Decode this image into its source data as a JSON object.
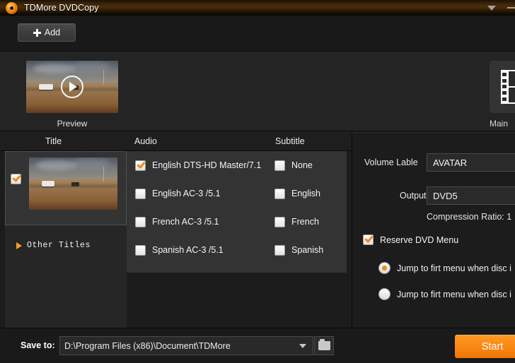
{
  "window": {
    "title": "TDMore DVDCopy",
    "app_icon": "dvd-disc-icon",
    "dropdown_icon": "chevron-down-icon",
    "minimize_icon": "minimize-icon",
    "accent_color": "#f28c13",
    "start_color": "#fa8a14"
  },
  "toolbar": {
    "add_label": "Add",
    "add_icon": "plus-icon"
  },
  "strip": {
    "preview_label": "Preview",
    "preview_play_icon": "play-icon",
    "main_label": "Main",
    "main_icon": "film-strip-icon"
  },
  "table": {
    "headers": [
      "Title",
      "Audio",
      "Subtitle"
    ],
    "title_row": {
      "checked": true,
      "thumbnail": "movie-thumbnail"
    },
    "other_titles_label": "Other Titles",
    "other_titles_icon": "triangle-right-icon",
    "audio_tracks": [
      {
        "label": "English DTS-HD Master/7.1",
        "checked": true
      },
      {
        "label": "English AC-3 /5.1",
        "checked": false
      },
      {
        "label": "French AC-3 /5.1",
        "checked": false
      },
      {
        "label": "Spanish AC-3 /5.1",
        "checked": false
      }
    ],
    "subtitles": [
      {
        "label": "None",
        "checked": false
      },
      {
        "label": "English",
        "checked": false
      },
      {
        "label": "French",
        "checked": false
      },
      {
        "label": "Spanish",
        "checked": false
      }
    ]
  },
  "settings": {
    "volume_label_caption": "Volume Lable",
    "volume_label_value": "AVATAR",
    "output_caption": "Output",
    "output_value": "DVD5",
    "compression_ratio": "Compression Ratio: 1",
    "reserve_menu_label": "Reserve DVD Menu",
    "reserve_menu_checked": true,
    "menu_options": [
      {
        "label": "Jump to firt menu when disc i",
        "selected": true
      },
      {
        "label": "Jump to firt menu when disc i",
        "selected": false
      }
    ]
  },
  "bottom": {
    "save_to_label": "Save to:",
    "save_to_path": "D:\\Program Files (x86)\\Document\\TDMore",
    "save_to_dropdown_icon": "chevron-down-icon",
    "browse_icon": "folder-icon",
    "start_label": "Start"
  }
}
